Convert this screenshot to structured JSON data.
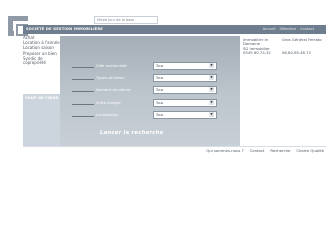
{
  "tagline": "Miseà Jour de la base",
  "company": "SOCIÉTÉ DE GESTION IMMOBILIÈRE",
  "top_nav": [
    "Accueil",
    "Sélection",
    "Contact"
  ],
  "sidebar": {
    "items": [
      "Achat",
      "Location à l'année",
      "Location saison",
      "Proposer un bien",
      "Syndic de copropriété"
    ],
    "panel_title": "COUP DE CŒUR"
  },
  "form": {
    "rows": [
      {
        "label": "Ville recherchée",
        "value": "Tous"
      },
      {
        "label": "Types de biens",
        "value": "Tous"
      },
      {
        "label": "Nombre de pièces",
        "value": "Tous"
      },
      {
        "label": "Votre budget",
        "value": "Tous"
      },
      {
        "label": "Localisation",
        "value": "Tous"
      }
    ],
    "submit": "Lancer la recherche"
  },
  "right": {
    "cells": [
      "Immobilier le Domaine",
      "Gros Général Ferrato",
      "SG Immobilier",
      "",
      "0545 60.74.32",
      "06.80.65.46.72"
    ]
  },
  "footer": [
    "Qui sommes-nous ?",
    "Contact",
    "Recherche",
    "Charte Qualité"
  ]
}
